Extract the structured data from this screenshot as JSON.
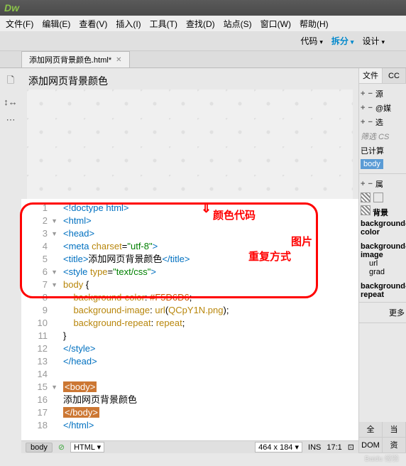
{
  "app": {
    "logo": "Dw"
  },
  "menu": {
    "file": "文件(F)",
    "edit": "编辑(E)",
    "view": "查看(V)",
    "insert": "插入(I)",
    "tools": "工具(T)",
    "find": "查找(D)",
    "site": "站点(S)",
    "window": "窗口(W)",
    "help": "帮助(H)"
  },
  "toolbar": {
    "code": "代码",
    "split": "拆分",
    "design": "设计"
  },
  "tab": {
    "title": "添加网页背景颜色.html*",
    "close": "✕"
  },
  "lefttools": {
    "file": "🗋",
    "ruler": "↕↔",
    "ellipsis": "⋯"
  },
  "preview": {
    "title": "添加网页背景颜色"
  },
  "code_lines": [
    "<!doctype html>",
    "<html>",
    "<head>",
    "<meta charset=\"utf-8\">",
    "<title>添加网页背景颜色</title>",
    "<style type=\"text/css\">",
    "body {",
    "    background-color: #F5D6D6;",
    "    background-image: url(QCpY1N.png);",
    "    background-repeat: repeat;",
    "}",
    "</style>",
    "</head>",
    "",
    "<body>",
    "添加网页背景颜色",
    "</body>",
    "</html>"
  ],
  "annotations": {
    "color_code": "颜色代码",
    "image": "图片",
    "repeat_mode": "重复方式",
    "arrow": "⇓"
  },
  "statusbar": {
    "tag": "body",
    "ok": "⊘",
    "lang": "HTML",
    "dim": "464 x 184",
    "ins": "INS",
    "pos": "17:1",
    "enc": "⊡"
  },
  "right": {
    "tabs": {
      "file": "文件",
      "cc": "CC"
    },
    "src": "源",
    "at": "@媒",
    "sele": "选",
    "filter": "筛选 CS",
    "computed": "已计算",
    "body_sel": "body",
    "prop": "属",
    "bg": "背景",
    "bgcolor": "background-color",
    "bgimage": "background-image",
    "url": "url",
    "grad": "grad",
    "bgrepeat": "background-repeat",
    "more": "更多",
    "all": "全",
    "current": "当",
    "dom": "DOM",
    "res": "资"
  },
  "watermark": "Baidu 经验"
}
